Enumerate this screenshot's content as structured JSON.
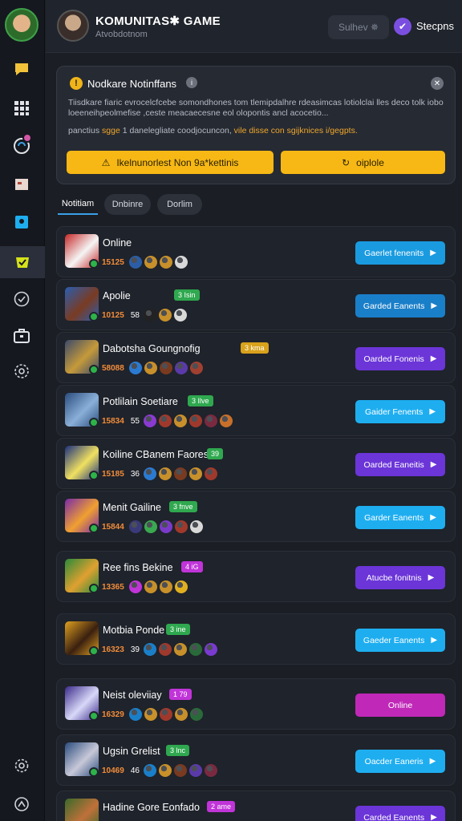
{
  "header": {
    "title": "KOMUNITAS✱ GAME",
    "subtitle": "Atvobdotnom",
    "button_label": "Sulhev ✵",
    "settings_label": "Stecpns"
  },
  "sidebar": {
    "icons": [
      "chat-icon",
      "apps-grid-icon",
      "controller-icon",
      "card-icon",
      "phone-icon",
      "gamepad-icon",
      "check-circle-icon",
      "briefcase-icon",
      "gear-badge-icon",
      "settings-icon",
      "logout-icon"
    ],
    "active": "gamepad-icon"
  },
  "notice": {
    "title": "Nodkare Notinffans",
    "body": "Tiisdkare fiaric evrocelcfcebe somondhones tom tlemipdalhre rdeasimcas lotiolclai lles deco tolk iobo loeeneihpeolmefise ,ceste meacaecesne eol olopontis ancl acocetio...",
    "hint_prefix": "panctius ",
    "hint_highlight_1": "sgge",
    "hint_middle": " 1 danelegliate coodjocuncon, ",
    "hint_highlight_2": "vile disse con sgijknices i/gegpts.",
    "btn_left": "Ikelnunorlest Non 9a*kettinis",
    "btn_right": "oiplole"
  },
  "tabs": [
    "Notitiam",
    "Dnbinre",
    "Dorlim"
  ],
  "colors": {
    "accent_yellow": "#f7b815",
    "blue": "#1a9be0",
    "blue_light": "#1eaef0",
    "purple": "#6b35d8",
    "magenta": "#c028b8",
    "online_green": "#2db34a"
  },
  "games": [
    {
      "name": "Online",
      "tag": "",
      "tag_color": "",
      "count": "15125",
      "num": "",
      "button": "Gaerlet fenenits",
      "btn_color": "#1a9be0",
      "thumb": [
        "#c62828",
        "#f5f5f5"
      ],
      "icons": [
        "#2b5ea7",
        "#c8902a",
        "#c8902a",
        "#d8d8d8"
      ]
    },
    {
      "name": "Apolie",
      "tag": "3 Isin",
      "tag_color": "#2fa84f",
      "count": "10125",
      "num": "58",
      "button": "Garded Eanents",
      "btn_color": "#1a7fc9",
      "thumb": [
        "#2a5db0",
        "#7a3b22"
      ],
      "icons": [
        "#222",
        "#c8902a",
        "#d8d8d8"
      ]
    },
    {
      "name": "Dabotsha Goungnofig",
      "tag": "3 kma",
      "tag_color": "#d9a21b",
      "count": "58088",
      "num": "",
      "button": "Oarded Fonenis",
      "btn_color": "#6b35d8",
      "thumb": [
        "#3b4a6b",
        "#c59a3a"
      ],
      "icons": [
        "#2b7ad1",
        "#c8902a",
        "#7a3a20",
        "#5a3aa8",
        "#a04030"
      ]
    },
    {
      "name": "Potlilain Soetiare",
      "tag": "3 Ilve",
      "tag_color": "#2fa84f",
      "count": "15834",
      "num": "55",
      "button": "Gaider Fenents",
      "btn_color": "#1eaef0",
      "thumb": [
        "#2a4c7e",
        "#8ab0d8"
      ],
      "icons": [
        "#8a3ad1",
        "#a0392c",
        "#c8902a",
        "#a0392c",
        "#7a2a40",
        "#c8702a"
      ]
    },
    {
      "name": "Koiline CBanem Faores",
      "tag": "39",
      "tag_color": "#2fa84f",
      "count": "15185",
      "num": "36",
      "button": "Oarded Eaneitis",
      "btn_color": "#6b35d8",
      "thumb": [
        "#1a2f7e",
        "#f0e060"
      ],
      "icons": [
        "#2b7ad1",
        "#c8902a",
        "#7a3a20",
        "#c8902a",
        "#a0392c"
      ]
    },
    {
      "name": "Menit Gailine",
      "tag": "3 fnve",
      "tag_color": "#2fa84f",
      "count": "15844",
      "num": "",
      "button": "Garder Eanents",
      "btn_color": "#1eaef0",
      "thumb": [
        "#7a2aa8",
        "#f0a030"
      ],
      "icons": [
        "#3a3a7a",
        "#3aa850",
        "#7a3ac8",
        "#a0392c",
        "#d8d8d8"
      ]
    },
    {
      "name": "Ree fins Bekine",
      "tag": "4 iG",
      "tag_color": "#c034d8",
      "count": "13365",
      "num": "",
      "button": "Atucbe fonitnis",
      "btn_color": "#6b35d8",
      "thumb": [
        "#2a8a3a",
        "#e0a030"
      ],
      "icons": [
        "#c034d8",
        "#c8902a",
        "#c8902a",
        "#e0b020"
      ]
    },
    {
      "name": "Motbia Ponde",
      "tag": "3 ine",
      "tag_color": "#2fa84f",
      "count": "16323",
      "num": "39",
      "button": "Gaeder Eanents",
      "btn_color": "#1eaef0",
      "thumb": [
        "#e0a020",
        "#3a2010"
      ],
      "icons": [
        "#1a7fc9",
        "#a0392c",
        "#c8902a",
        "#2a6a3a",
        "#7a3ad1"
      ]
    },
    {
      "name": "Neist oleviiay",
      "tag": "1 79",
      "tag_color": "#c034d8",
      "count": "16329",
      "num": "",
      "button": "Online",
      "btn_color": "#c028b8",
      "thumb": [
        "#3a2a8a",
        "#d8d8f8"
      ],
      "icons": [
        "#1a7fc9",
        "#c8902a",
        "#a0392c",
        "#c8902a",
        "#2a6a3a"
      ]
    },
    {
      "name": "Ugsin Grelist",
      "tag": "3 lnc",
      "tag_color": "#2fa84f",
      "count": "10469",
      "num": "46",
      "button": "Oacder Eaneris",
      "btn_color": "#1eaef0",
      "thumb": [
        "#2a4c7e",
        "#c8c8d8"
      ],
      "icons": [
        "#1a7fc9",
        "#c8902a",
        "#7a3a20",
        "#5a3aa8",
        "#7a2a40"
      ]
    },
    {
      "name": "Hadine Gore Eonfado",
      "tag": "2 ame",
      "tag_color": "#c034d8",
      "count": "",
      "num": "",
      "button": "Carded Eanents",
      "btn_color": "#6b35d8",
      "thumb": [
        "#3a6a2a",
        "#c0703a"
      ],
      "icons": []
    }
  ]
}
